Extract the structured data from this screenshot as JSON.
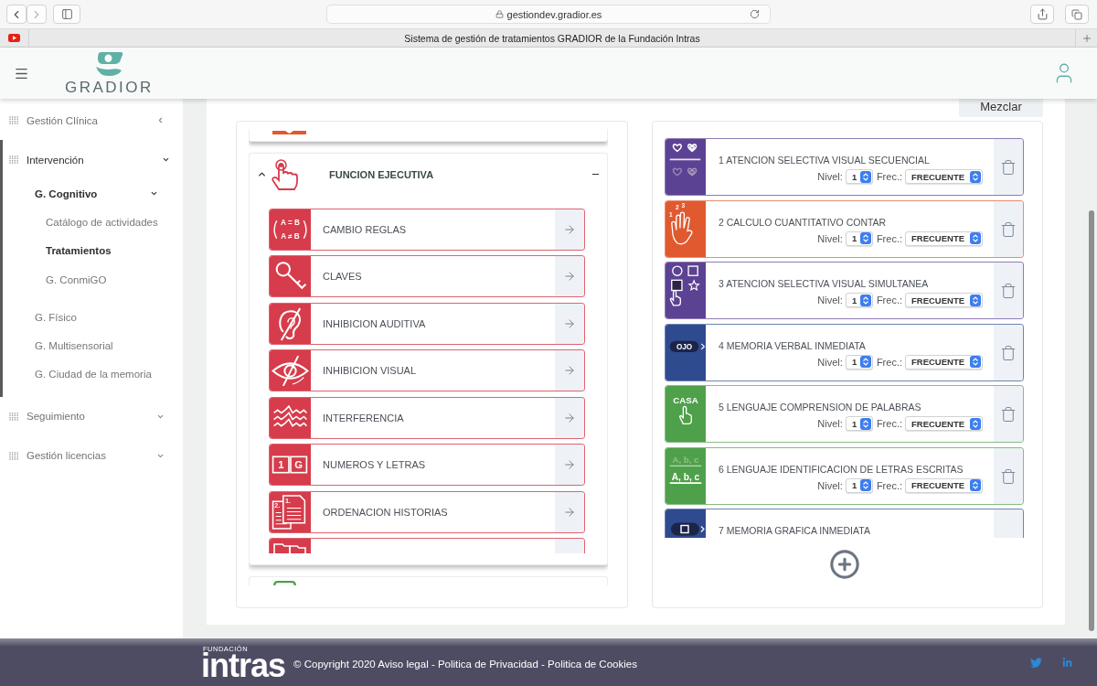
{
  "browser": {
    "forward_disabled": true,
    "url": "gestiondev.gradior.es",
    "tab_title": "Sistema de gestión de tratamientos GRADIOR de la Fundación Intras"
  },
  "header": {
    "logo": "GRADIOR"
  },
  "sidebar": {
    "items": [
      {
        "label": "Gestión Clínica",
        "kind": "submenu",
        "expanded": false
      },
      {
        "label": "Intervención",
        "kind": "dropdown",
        "expanded": true,
        "children": [
          {
            "label": "G. Cognitivo",
            "expanded": true,
            "children": [
              {
                "label": "Catálogo de actividades",
                "selected": false
              },
              {
                "label": "Tratamientos",
                "selected": true
              },
              {
                "label": "G. ConmiGO",
                "selected": false
              }
            ]
          },
          {
            "label": "G. Físico",
            "selected": false
          },
          {
            "label": "G. Multisensorial",
            "selected": false
          },
          {
            "label": "G. Ciudad de la memoria",
            "selected": false
          }
        ]
      },
      {
        "label": "Seguimiento",
        "kind": "dropdown",
        "expanded": false
      },
      {
        "label": "Gestión licencias",
        "kind": "dropdown",
        "expanded": false
      }
    ]
  },
  "shuffle_button": "Mezclar",
  "catalog_panel": {
    "categories": [
      {
        "kind": "stub",
        "color": "#e0592f"
      },
      {
        "kind": "panel",
        "title": "FUNCION EJECUTIVA",
        "color": "#d63c4b",
        "expanded": true,
        "items": [
          {
            "label": "CAMBIO REGLAS",
            "kind": "rules",
            "icon_text": [
              "A = B",
              "A ≠ B"
            ]
          },
          {
            "label": "CLAVES",
            "kind": "key"
          },
          {
            "label": "INHIBICION AUDITIVA",
            "kind": "ear"
          },
          {
            "label": "INHIBICION VISUAL",
            "kind": "eye"
          },
          {
            "label": "INTERFERENCIA",
            "kind": "waves"
          },
          {
            "label": "NUMEROS Y LETRAS",
            "kind": "number-letter",
            "icon_text": [
              "1",
              "G"
            ]
          },
          {
            "label": "ORDENACION HISTORIAS",
            "kind": "pages",
            "icon_text": [
              "2.",
              "1."
            ]
          },
          {
            "kind": "folders"
          }
        ]
      },
      {
        "kind": "stub",
        "color": "#4fa04a"
      }
    ]
  },
  "treatment_panel": {
    "activities": [
      {
        "title": "1 ATENCION SELECTIVA VISUAL SECUENCIAL",
        "kind": "hearts",
        "color": "#5c4293",
        "nivel_label": "Nivel:",
        "nivel": "1",
        "frec_label": "Frec.:",
        "frec": "FRECUENTE"
      },
      {
        "title": "2 CALCULO CUANTITATIVO CONTAR",
        "kind": "counting-hand",
        "color": "#e0592f",
        "icon_text": [
          "1",
          "2",
          "3"
        ],
        "nivel_label": "Nivel:",
        "nivel": "1",
        "frec_label": "Frec.:",
        "frec": "FRECUENTE"
      },
      {
        "title": "3 ATENCION SELECTIVA VISUAL SIMULTANEA",
        "kind": "shapes",
        "color": "#5c4293",
        "nivel_label": "Nivel:",
        "nivel": "1",
        "frec_label": "Frec.:",
        "frec": "FRECUENTE"
      },
      {
        "title": "4 MEMORIA VERBAL INMEDIATA",
        "kind": "word-tag",
        "color": "#2f4b8f",
        "icon_text": [
          "OJO"
        ],
        "nivel_label": "Nivel:",
        "nivel": "1",
        "frec_label": "Frec.:",
        "frec": "FRECUENTE"
      },
      {
        "title": "5 LENGUAJE COMPRENSION DE PALABRAS",
        "kind": "word-hand",
        "color": "#4fa04a",
        "icon_text": [
          "CASA"
        ],
        "nivel_label": "Nivel:",
        "nivel": "1",
        "frec_label": "Frec.:",
        "frec": "FRECUENTE"
      },
      {
        "title": "6 LENGUAJE IDENTIFICACION DE LETRAS ESCRITAS",
        "kind": "letters",
        "color": "#4fa04a",
        "icon_text": [
          "A, b, c",
          "A, b, c"
        ],
        "nivel_label": "Nivel:",
        "nivel": "1",
        "frec_label": "Frec.:",
        "frec": "FRECUENTE"
      },
      {
        "title": "7 MEMORIA GRAFICA INMEDIATA",
        "kind": "square-tag",
        "color": "#2f4b8f"
      }
    ]
  },
  "footer": {
    "logo_small": "FUNDACIÓN",
    "logo": "intras",
    "copyright": "© Copyright 2020",
    "links": [
      "Aviso legal",
      "Politica de Privacidad",
      "Politica de Cookies"
    ],
    "separator": "-"
  }
}
